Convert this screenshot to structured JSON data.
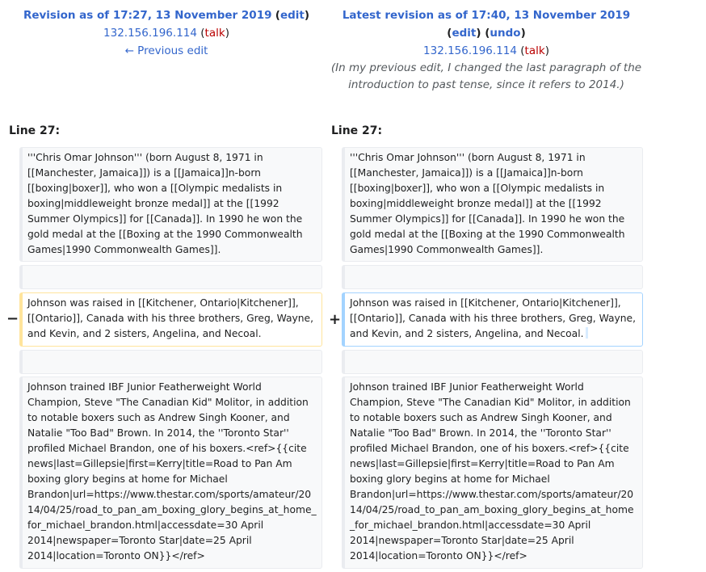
{
  "left_header": {
    "title": "Revision as of 17:27, 13 November 2019",
    "edit_label": "edit",
    "user": "132.156.196.114",
    "talk_label": "talk",
    "prev_edit": "← Previous edit"
  },
  "right_header": {
    "title": "Latest revision as of 17:40, 13 November 2019",
    "edit_label": "edit",
    "undo_label": "undo",
    "user": "132.156.196.114",
    "talk_label": "talk",
    "comment": "(In my previous edit, I changed the last paragraph of the introduction to past tense, since it refers to 2014.)"
  },
  "line_numbers": {
    "left": "Line 27:",
    "right": "Line 27:"
  },
  "markers": {
    "minus": "−",
    "plus": "+"
  },
  "diff": {
    "para1": "'''Chris Omar Johnson''' (born August 8, 1971 in [[Manchester, Jamaica]]) is a [[Jamaica]]n-born [[boxing|boxer]], who won a [[Olympic medalists in boxing|middleweight bronze medal]] at the [[1992 Summer Olympics]] for [[Canada]]. In 1990 he won the gold medal at the [[Boxing at the 1990 Commonwealth Games|1990 Commonwealth Games]].",
    "left_changed": "Johnson was raised in [[Kitchener, Ontario|Kitchener]], [[Ontario]], Canada with his three brothers, Greg, Wayne, and Kevin, and 2 sisters, Angelina, and Necoal.",
    "right_changed": "Johnson was raised in [[Kitchener, Ontario|Kitchener]], [[Ontario]], Canada with his three brothers, Greg, Wayne, and Kevin, and 2 sisters, Angelina, and Necoal.",
    "para3": "Johnson trained IBF Junior Featherweight World Champion, Steve \"The Canadian Kid\" Molitor, in addition to notable boxers such as Andrew Singh Kooner, and Natalie \"Too Bad\" Brown. In 2014, the ''Toronto Star'' profiled Michael Brandon, one of his boxers.<ref>{{cite news|last=Gillepsie|first=Kerry|title=Road to Pan Am boxing glory begins at home for Michael Brandon|url=https://www.thestar.com/sports/amateur/2014/04/25/road_to_pan_am_boxing_glory_begins_at_home_for_michael_brandon.html|accessdate=30 April 2014|newspaper=Toronto Star|date=25 April 2014|location=Toronto ON}}</ref>"
  }
}
